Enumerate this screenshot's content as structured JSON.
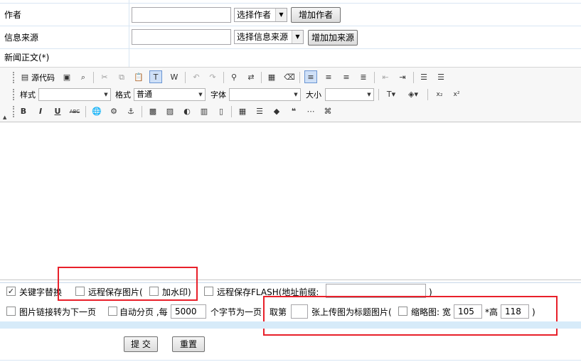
{
  "author": {
    "label": "作者",
    "select_value": "选择作者",
    "add_button": "增加作者"
  },
  "source": {
    "label": "信息来源",
    "select_value": "选择信息来源",
    "add_button": "增加加来源"
  },
  "content": {
    "label": "新闻正文(*)"
  },
  "toolbar": {
    "source_code": "源代码",
    "style_label": "样式",
    "format_label": "格式",
    "format_value": "普通",
    "font_label": "字体",
    "size_label": "大小"
  },
  "options": {
    "keyword_replace": "关键字替换",
    "remote_save_image": "远程保存图片(",
    "watermark": "加水印)",
    "remote_save_flash": "远程保存FLASH(地址前缀:",
    "flash_close": ")",
    "image_link_next": "图片链接转为下一页",
    "auto_paging": "自动分页 ,每",
    "auto_paging_value": "5000",
    "chars_per_page": "个字节为一页",
    "take_nth": "取第",
    "uploaded_as_title": "张上传图为标题图片(",
    "thumbnail": "缩略图: 宽",
    "width_value": "105",
    "height_label": "*高",
    "height_value": "118",
    "close_paren": ")"
  },
  "actions": {
    "submit": "提 交",
    "reset": "重置"
  },
  "colors": {
    "highlight_box": "#e8202a",
    "border": "#d9e6f3",
    "bar": "#d7ebf9"
  }
}
